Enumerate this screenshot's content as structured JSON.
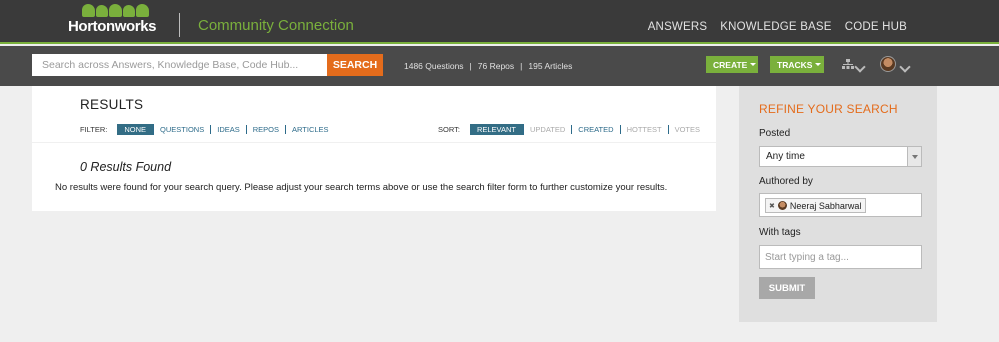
{
  "header": {
    "logo_text": "Hortonworks",
    "site_title": "Community Connection",
    "nav": [
      "ANSWERS",
      "KNOWLEDGE BASE",
      "CODE HUB"
    ]
  },
  "searchbar": {
    "placeholder": "Search across Answers, Knowledge Base, Code Hub...",
    "button_label": "SEARCH",
    "stats": {
      "questions": "1486 Questions",
      "repos": "76 Repos",
      "articles": "195 Articles"
    },
    "create_label": "CREATE",
    "tracks_label": "TRACKS"
  },
  "results": {
    "title": "RESULTS",
    "filter_label": "FILTER:",
    "filters": [
      "NONE",
      "QUESTIONS",
      "IDEAS",
      "REPOS",
      "ARTICLES"
    ],
    "sort_label": "SORT:",
    "sorts": [
      "RELEVANT",
      "UPDATED",
      "CREATED",
      "HOTTEST",
      "VOTES"
    ],
    "empty_title": "0 Results Found",
    "empty_message": "No results were found for your search query. Please adjust your search terms above or use the search filter form to further customize your results."
  },
  "sidebar": {
    "title": "REFINE YOUR SEARCH",
    "posted_label": "Posted",
    "posted_value": "Any time",
    "authored_label": "Authored by",
    "author_chip": "Neeraj Sabharwal",
    "tags_label": "With tags",
    "tags_placeholder": "Start typing a tag...",
    "submit_label": "SUBMIT"
  },
  "colors": {
    "accent_green": "#7ab03c",
    "accent_orange": "#e46c1c",
    "active_filter": "#336d85"
  }
}
